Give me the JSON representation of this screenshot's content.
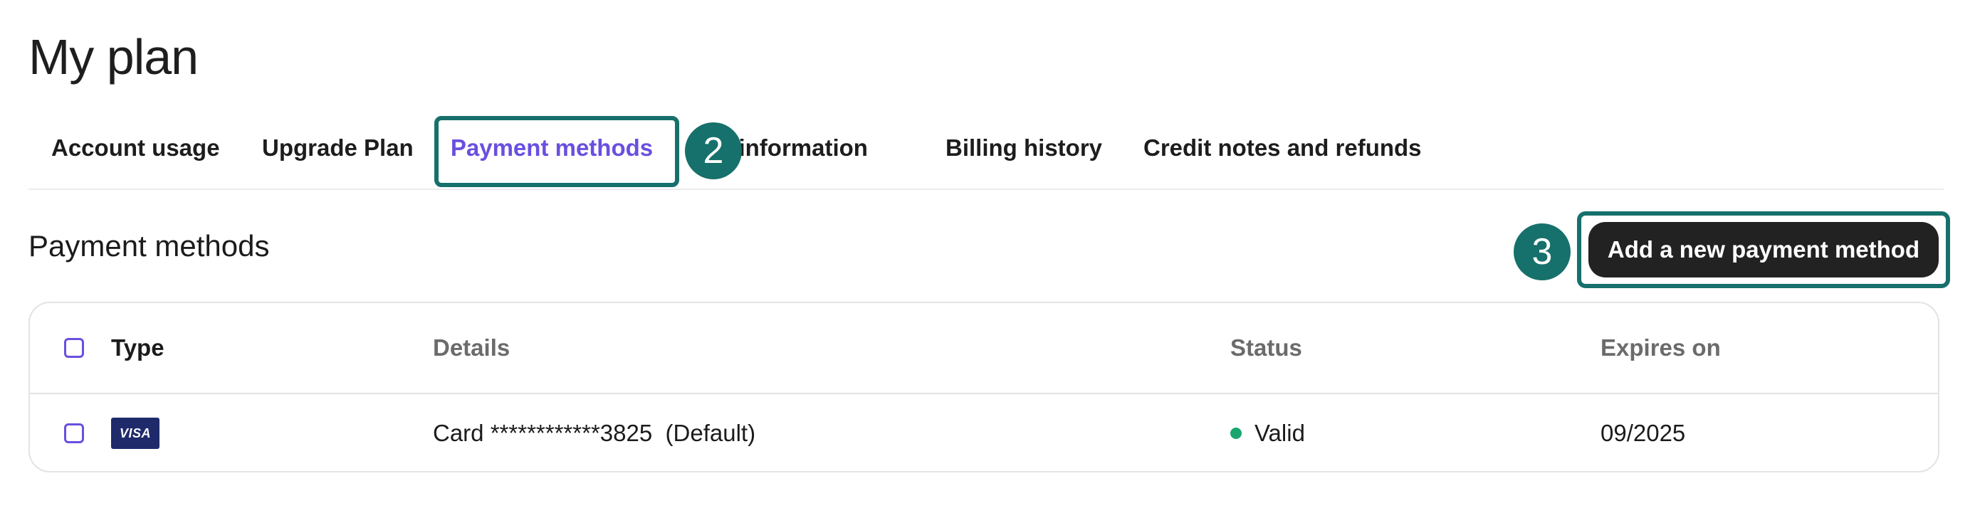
{
  "page": {
    "title": "My plan"
  },
  "tabs": [
    {
      "label": "Account usage"
    },
    {
      "label": "Upgrade Plan"
    },
    {
      "label": "Payment methods",
      "active": true
    },
    {
      "label": "Billing information",
      "visible_text": "ng information"
    },
    {
      "label": "Billing history"
    },
    {
      "label": "Credit notes and refunds"
    }
  ],
  "annotations": {
    "step_2": "2",
    "step_3": "3"
  },
  "section": {
    "title": "Payment methods",
    "add_button_label": "Add a new payment method"
  },
  "table": {
    "columns": [
      "Type",
      "Details",
      "Status",
      "Expires on"
    ],
    "rows": [
      {
        "type_icon": "visa-card-icon",
        "type_text": "VISA",
        "details": "Card ************3825  (Default)",
        "status": "Valid",
        "expires": "09/2025"
      }
    ]
  },
  "colors": {
    "accent_purple": "#6a4fe0",
    "annotation_teal": "#16706b",
    "status_valid": "#1aa56f",
    "button_dark": "#222222",
    "visa_blue": "#1f2a6b"
  }
}
